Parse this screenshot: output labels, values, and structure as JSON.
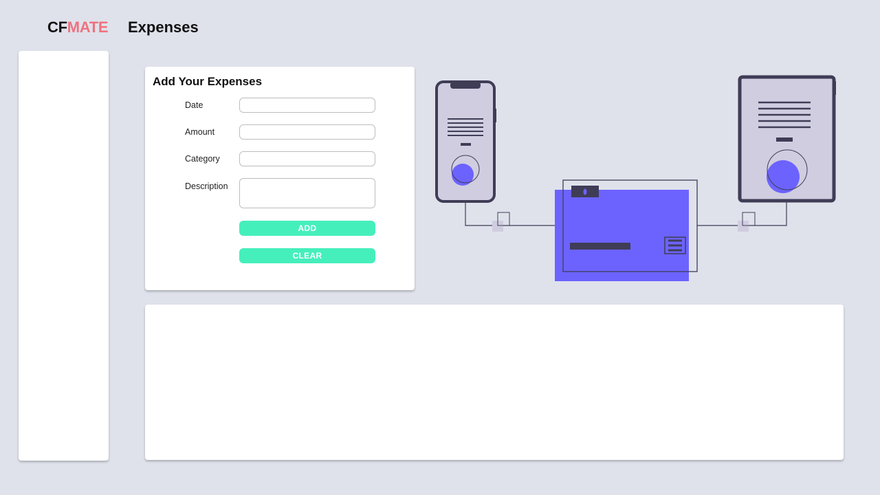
{
  "header": {
    "logo_part1": "CF",
    "logo_part2": "MATE",
    "page_title": "Expenses"
  },
  "form": {
    "title": "Add Your Expenses",
    "fields": {
      "date": {
        "label": "Date",
        "value": ""
      },
      "amount": {
        "label": "Amount",
        "value": ""
      },
      "category": {
        "label": "Category",
        "value": ""
      },
      "description": {
        "label": "Description",
        "value": ""
      }
    },
    "add_label": "ADD",
    "clear_label": "CLEAR"
  },
  "colors": {
    "background": "#dfe2eb",
    "accent_pink": "#f0717f",
    "button_green": "#45efbb",
    "illustration_purple": "#6c63ff",
    "illustration_dark": "#3f3d56",
    "illustration_light": "#d0cde1"
  },
  "illustration": {
    "icon": "payment-devices-illustration"
  }
}
